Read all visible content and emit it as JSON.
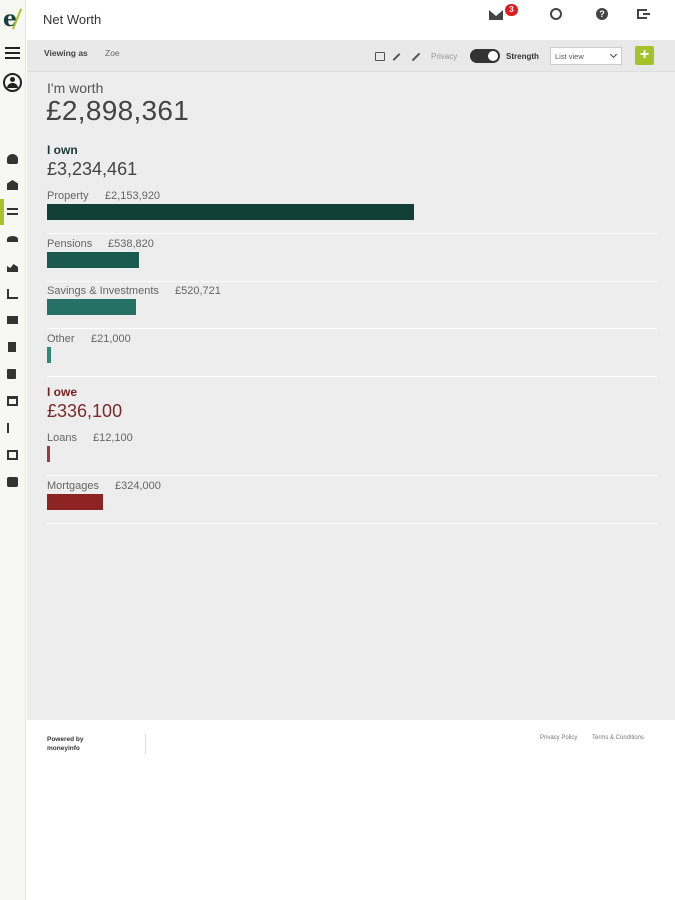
{
  "header": {
    "title": "Net Worth",
    "unread_count": "3"
  },
  "subbar": {
    "viewing_label": "Viewing as",
    "viewing_name": "Zoe",
    "privacy_label": "Privacy",
    "strength_label": "Strength",
    "view_select": "List view",
    "add_label": "+"
  },
  "summary": {
    "worth_label": "I'm worth",
    "worth_value": "£2,898,361",
    "own_label": "I own",
    "own_value": "£3,234,461",
    "owe_label": "I owe",
    "owe_value": "£336,100"
  },
  "assets": [
    {
      "name": "Property",
      "amount": "£2,153,920",
      "value": 2153920
    },
    {
      "name": "Pensions",
      "amount": "£538,820",
      "value": 538820
    },
    {
      "name": "Savings & Investments",
      "amount": "£520,721",
      "value": 520721
    },
    {
      "name": "Other",
      "amount": "£21,000",
      "value": 21000
    }
  ],
  "liabilities": [
    {
      "name": "Loans",
      "amount": "£12,100",
      "value": 12100
    },
    {
      "name": "Mortgages",
      "amount": "£324,000",
      "value": 324000
    }
  ],
  "footer": {
    "powered_by": "Powered by moneyinfo",
    "privacy_link": "Privacy Policy",
    "terms_link": "Terms & Conditions"
  },
  "colors": {
    "accent": "#a4c22a",
    "asset_bars": [
      "#123f38",
      "#1b5a51",
      "#257166",
      "#2d8a7b"
    ],
    "liability_bars": [
      "#a0393d",
      "#8e2323"
    ]
  },
  "icons": {
    "rail": [
      "menu-icon",
      "user-circle-icon",
      "dashboard-icon",
      "bank-icon",
      "transfer-icon",
      "umbrella-icon",
      "chart-area-icon",
      "bar-chart-icon",
      "envelope-icon",
      "document-icon",
      "video-icon",
      "calendar-icon",
      "flag-icon",
      "calendar-check-icon",
      "briefcase-icon"
    ]
  }
}
